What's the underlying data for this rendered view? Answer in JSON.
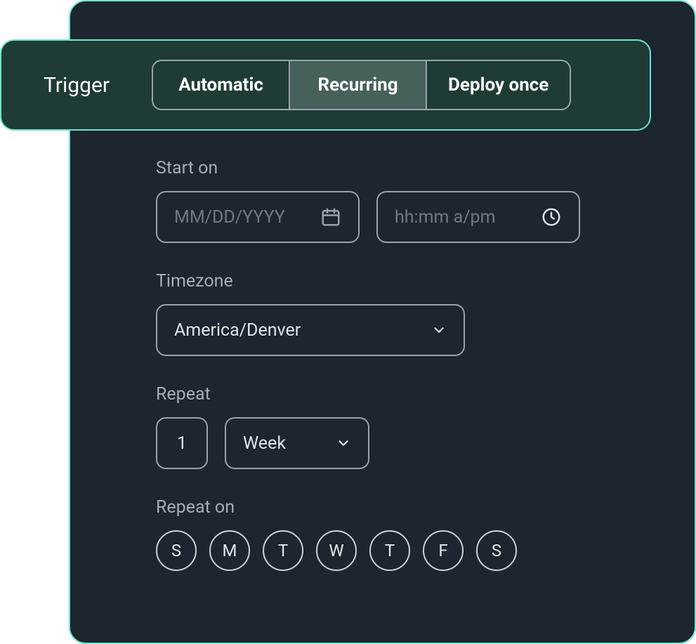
{
  "trigger": {
    "label": "Trigger",
    "options": [
      "Automatic",
      "Recurring",
      "Deploy once"
    ],
    "selected": "Recurring"
  },
  "form": {
    "start_on_label": "Start on",
    "date_placeholder": "MM/DD/YYYY",
    "time_placeholder": "hh:mm a/pm",
    "timezone_label": "Timezone",
    "timezone_value": "America/Denver",
    "repeat_label": "Repeat",
    "repeat_count": "1",
    "repeat_unit": "Week",
    "repeat_on_label": "Repeat on",
    "days": [
      "S",
      "M",
      "T",
      "W",
      "T",
      "F",
      "S"
    ]
  }
}
